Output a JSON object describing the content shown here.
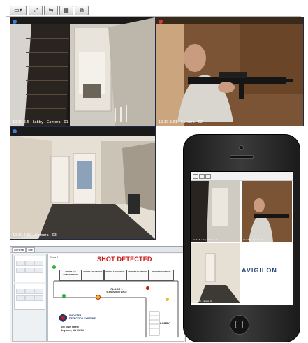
{
  "toolbar": {
    "buttons": [
      "layout-icon",
      "fullscreen-icon",
      "swap-icon",
      "grid-icon",
      "popout-icon"
    ]
  },
  "cameras": [
    {
      "label": "10.10.6.5 - Lobby - Camera - 01",
      "status_color": "#3b7fd6"
    },
    {
      "label": "10.10.6.61 - Camera - 02",
      "status_color": "#d63b3b"
    },
    {
      "label": "10.10.6.62 - Camera - 03",
      "status_color": "#3b7fd6"
    }
  ],
  "floorplan": {
    "tabs": [
      "General",
      "Site"
    ],
    "view_label": "Floor 1",
    "alert": "SHOT DETECTED",
    "rooms": [
      "ROOM 110 CONFERENCE",
      "ROOM 120 OFFICE",
      "ROOM 130 OFFICE",
      "ROOM 140 OFFICE",
      "ROOM 150 OFFICE"
    ],
    "floor_title": "FLOOR 1",
    "floor_subtitle": "SUPERVISOR WALK",
    "lobby": "LOBBY",
    "company_name": "SHOOTER DETECTION SYSTEMS",
    "address_line1": "300 Main Street",
    "address_line2": "Anytown, MA 01234",
    "colors": {
      "alert": "#cc1111",
      "sensor_green": "#2fae3a",
      "sensor_yellow": "#e3c21a",
      "sensor_red": "#c81919"
    }
  },
  "phone": {
    "brand": "AVIGILON",
    "cameras": [
      {
        "label": "10.10.6.5 - Lobby - Camera - 01"
      },
      {
        "label": "10.10.6.61 - Camera - 02"
      },
      {
        "label": "10.10.6.62 - Camera - 03"
      }
    ]
  }
}
